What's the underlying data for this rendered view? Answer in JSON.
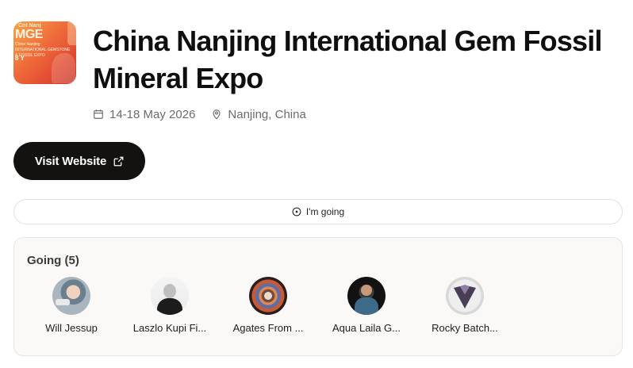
{
  "event": {
    "thumbnail": {
      "small_text": "Cnt Nanj",
      "big_text": "MGE",
      "line_text": "China Nanjing INTERNATIONAL GEMSTONE & FOSSIL EXPO",
      "year_text": "8 Y"
    },
    "title": "China Nanjing International Gem Fossil Mineral Expo",
    "date": "14-18 May 2026",
    "location": "Nanjing, China",
    "calendar_icon": "calendar-icon",
    "location_icon": "map-pin-icon"
  },
  "actions": {
    "visit_label": "Visit Website",
    "visit_icon": "external-link-icon",
    "going_label": "I'm going",
    "going_icon": "circle-dot-icon"
  },
  "going": {
    "title": "Going (5)",
    "attendees": [
      {
        "name": "Will Jessup"
      },
      {
        "name": "Laszlo Kupi Fi..."
      },
      {
        "name": "Agates From ..."
      },
      {
        "name": "Aqua Laila G..."
      },
      {
        "name": "Rocky Batch..."
      }
    ]
  }
}
